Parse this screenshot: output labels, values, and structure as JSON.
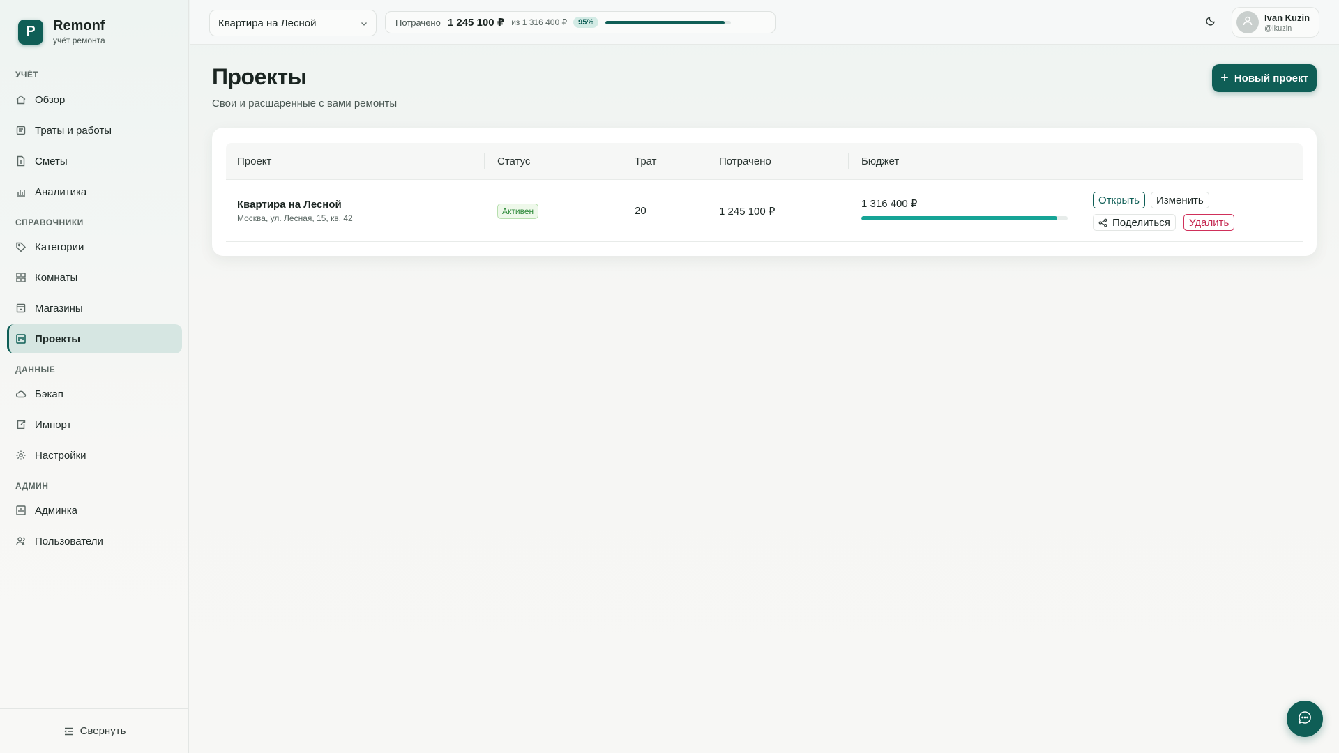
{
  "brand": {
    "logo_letter": "Р",
    "name": "Remonf",
    "subtitle": "учёт ремонта"
  },
  "sidebar": {
    "sections": [
      {
        "title": "УЧЁТ",
        "items": [
          {
            "label": "Обзор",
            "icon": "home-icon"
          },
          {
            "label": "Траты и работы",
            "icon": "receipt-icon"
          },
          {
            "label": "Сметы",
            "icon": "document-icon"
          },
          {
            "label": "Аналитика",
            "icon": "bar-chart-icon"
          }
        ]
      },
      {
        "title": "СПРАВОЧНИКИ",
        "items": [
          {
            "label": "Категории",
            "icon": "tag-icon"
          },
          {
            "label": "Комнаты",
            "icon": "grid-icon"
          },
          {
            "label": "Магазины",
            "icon": "store-icon"
          },
          {
            "label": "Проекты",
            "icon": "kanban-icon",
            "active": true
          }
        ]
      },
      {
        "title": "ДАННЫЕ",
        "items": [
          {
            "label": "Бэкап",
            "icon": "cloud-icon"
          },
          {
            "label": "Импорт",
            "icon": "import-icon"
          },
          {
            "label": "Настройки",
            "icon": "gear-icon"
          }
        ]
      },
      {
        "title": "АДМИН",
        "items": [
          {
            "label": "Админка",
            "icon": "admin-chart-icon"
          },
          {
            "label": "Пользователи",
            "icon": "users-icon"
          }
        ]
      }
    ],
    "collapse_label": "Свернуть"
  },
  "topbar": {
    "project_select_value": "Квартира на Лесной",
    "spent_label": "Потрачено",
    "spent_value": "1 245 100 ₽",
    "spent_of": "из 1 316 400 ₽",
    "spent_pct": "95%",
    "spent_fraction": 0.95,
    "theme_icon": "moon-icon",
    "user_name": "Ivan Kuzin",
    "user_handle": "@ikuzin"
  },
  "main": {
    "title": "Проекты",
    "subtitle": "Свои и расшаренные с вами ремонты",
    "new_button_label": "Новый проект",
    "table": {
      "headers": [
        "Проект",
        "Статус",
        "Трат",
        "Потрачено",
        "Бюджет",
        ""
      ],
      "rows": [
        {
          "name": "Квартира на Лесной",
          "address": "Москва, ул. Лесная, 15, кв. 42",
          "status": "Активен",
          "count": "20",
          "spent": "1 245 100 ₽",
          "budget": "1 316 400 ₽",
          "budget_fraction": 0.95,
          "actions": {
            "open": "Открыть",
            "edit": "Изменить",
            "share": "Поделиться",
            "delete": "Удалить"
          }
        }
      ]
    }
  },
  "colors": {
    "accent": "#0f5e56",
    "budget_bar": "#16a496",
    "danger": "#c4264f",
    "status_active": "#2e8a3a"
  }
}
